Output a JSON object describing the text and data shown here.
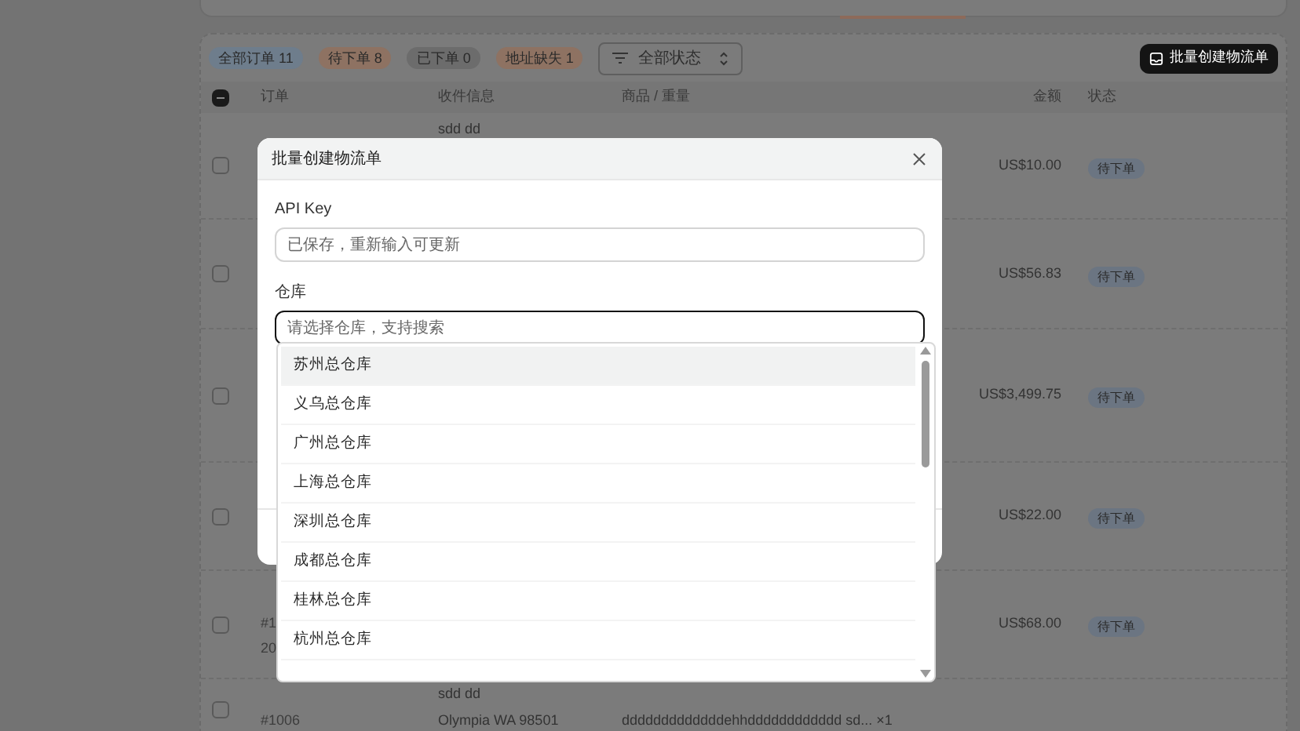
{
  "filters": [
    {
      "label": "全部订单 11",
      "color": "#6e7d8c"
    },
    {
      "label": "待下单 8",
      "color": "#8e7262"
    },
    {
      "label": "已下单 0",
      "color": "#6c6c6c"
    },
    {
      "label": "地址缺失 1",
      "color": "#8e7262"
    }
  ],
  "status_select": {
    "value": "全部状态"
  },
  "bulk_button": {
    "label": "批量创建物流单"
  },
  "table": {
    "select_all": {
      "indeterminate": true
    },
    "columns": [
      "订单",
      "收件信息",
      "商品 / 重量",
      "金额",
      "状态"
    ],
    "rows": [
      {
        "order": [],
        "recipient": [
          "sdd dd"
        ],
        "product": "",
        "amount": "US$10.00",
        "status": "待下单",
        "checked": false
      },
      {
        "order": [],
        "recipient": [],
        "product": "",
        "amount": "US$56.83",
        "status": "待下单",
        "checked": false
      },
      {
        "order": [],
        "recipient": [],
        "product": "",
        "amount": "US$3,499.75",
        "status": "待下单",
        "checked": false
      },
      {
        "order": [],
        "recipient": [],
        "product": "",
        "amount": "US$22.00",
        "status": "待下单",
        "checked": false
      },
      {
        "order": [
          "#1",
          "20"
        ],
        "recipient": [],
        "product": "",
        "amount": "US$68.00",
        "status": "待下单",
        "checked": false
      },
      {
        "order": [
          "#1006"
        ],
        "recipient": [
          "sdd dd",
          "Olympia WA 98501"
        ],
        "product": "dddddddddddddehhdddddddddddd sd... ×1",
        "amount": "",
        "status": "",
        "checked": false
      }
    ]
  },
  "dialog": {
    "title": "批量创建物流单",
    "fields": [
      {
        "label": "API Key",
        "placeholder": "已保存，重新输入可更新",
        "focused": false
      },
      {
        "label": "仓库",
        "placeholder": "请选择仓库，支持搜索",
        "focused": true
      }
    ]
  },
  "dropdown": {
    "options": [
      {
        "label": "苏州总仓库",
        "highlighted": true
      },
      {
        "label": "义乌总仓库",
        "highlighted": false
      },
      {
        "label": "广州总仓库",
        "highlighted": false
      },
      {
        "label": "上海总仓库",
        "highlighted": false
      },
      {
        "label": "深圳总仓库",
        "highlighted": false
      },
      {
        "label": "成都总仓库",
        "highlighted": false
      },
      {
        "label": "桂林总仓库",
        "highlighted": false
      },
      {
        "label": "杭州总仓库",
        "highlighted": false
      }
    ]
  }
}
